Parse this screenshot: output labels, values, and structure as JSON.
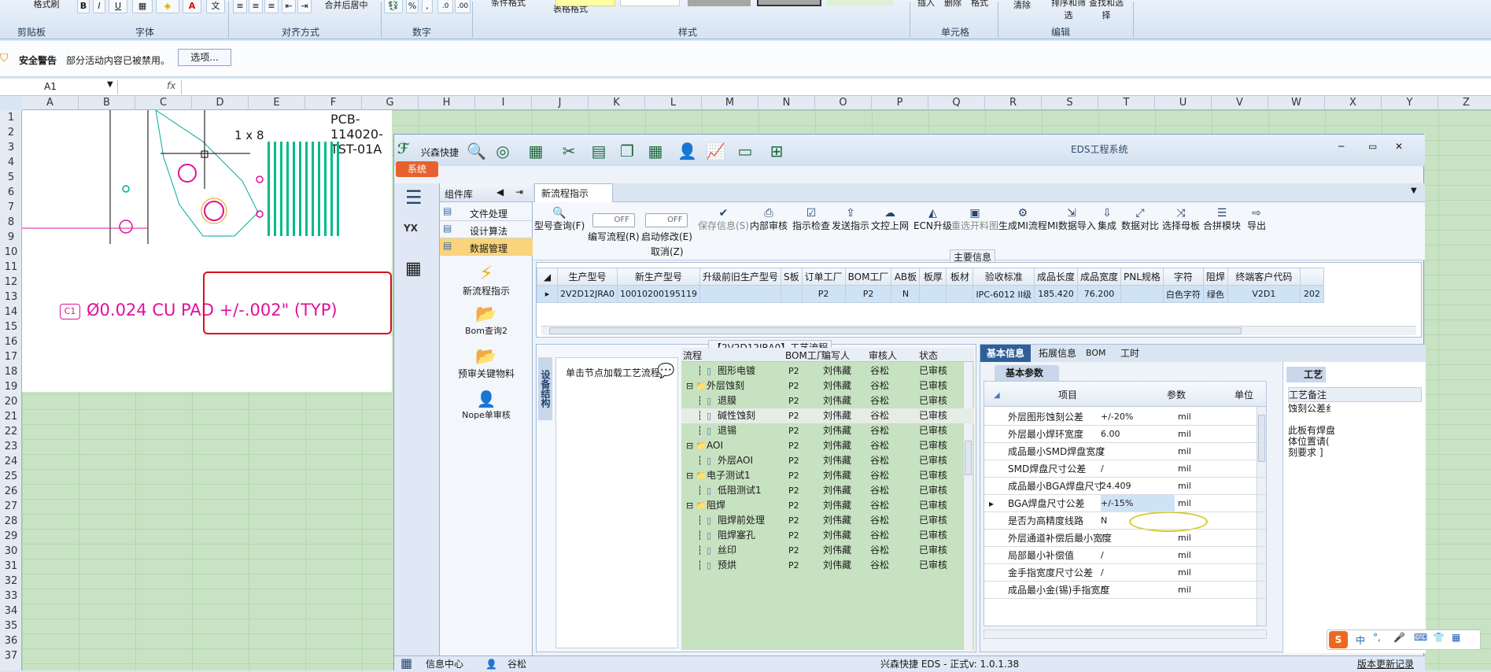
{
  "ribbon": {
    "groups": [
      "剪贴板",
      "字体",
      "对齐方式",
      "数字",
      "样式",
      "单元格",
      "编辑"
    ],
    "format_painter": "格式刷",
    "merge_center": "合并后居中",
    "percent": "%",
    "comma": ",",
    "table_format": "表格格式",
    "conditional": "条件格式",
    "clear": "清除",
    "sort_filter": "排序和筛选",
    "find_select": "查找和选择",
    "insert": "插入",
    "delete": "删除",
    "format": "格式"
  },
  "security_bar": {
    "title": "安全警告",
    "message": "部分活动内容已被禁用。",
    "options_button": "选项..."
  },
  "formula_bar": {
    "name_box": "A1",
    "fx": "fx"
  },
  "columns": [
    "A",
    "B",
    "C",
    "D",
    "E",
    "F",
    "G",
    "H",
    "I",
    "J",
    "K",
    "L",
    "M",
    "N",
    "O",
    "P",
    "Q",
    "R",
    "S",
    "T",
    "U",
    "V",
    "W",
    "X",
    "Y",
    "Z"
  ],
  "rows": [
    "1",
    "2",
    "3",
    "4",
    "5",
    "6",
    "7",
    "8",
    "9",
    "10",
    "11",
    "12",
    "13",
    "14",
    "15",
    "16",
    "17",
    "18",
    "19",
    "20",
    "21",
    "22",
    "23",
    "24",
    "25",
    "26",
    "27",
    "28",
    "29",
    "30",
    "31",
    "32",
    "33",
    "34",
    "35",
    "36",
    "37"
  ],
  "drawing": {
    "title": "PCB-114020-TST-01A",
    "dim_label": "1 x 8",
    "callout_tag": "C1",
    "callout_text": "Ø0.024 CU PAD +/-.002\" (TYP)"
  },
  "eds": {
    "window_title": "EDS工程系统",
    "brand": "兴森快捷",
    "system_tab": "系统",
    "component_header": "组件库",
    "menu": [
      "文件处理",
      "设计算法",
      "数据管理"
    ],
    "components": [
      "新流程指示",
      "Bom查询2",
      "预审关键物料",
      "Nope单审核"
    ],
    "main_tab": "新流程指示",
    "toolbar": [
      {
        "label": "型号查询(F)",
        "icon": "search-icon"
      },
      {
        "label": "编写流程(R)",
        "icon": "toggle-icon"
      },
      {
        "label": "启动修改(E)",
        "icon": "toggle-icon"
      },
      {
        "label": "保存信息(S)",
        "icon": "check-icon"
      },
      {
        "label": "内部审核",
        "icon": "print-icon"
      },
      {
        "label": "指示检查",
        "icon": "checkbox-icon"
      },
      {
        "label": "发送指示",
        "icon": "upload-icon"
      },
      {
        "label": "文控上网",
        "icon": "cloud-icon"
      },
      {
        "label": "ECN升级",
        "icon": "ecn-icon"
      },
      {
        "label": "重选开料图",
        "icon": "image-icon"
      },
      {
        "label": "生成MI流程",
        "icon": "gear-icon"
      },
      {
        "label": "MI数据导入",
        "icon": "import-icon"
      },
      {
        "label": "集成",
        "icon": "download-icon"
      },
      {
        "label": "数据对比",
        "icon": "compare-icon"
      },
      {
        "label": "选择母板",
        "icon": "shuffle-icon"
      },
      {
        "label": "合拼模块",
        "icon": "list-icon"
      },
      {
        "label": "导出",
        "icon": "export-icon"
      }
    ],
    "toggle_off": "OFF",
    "cancel_label": "取消(Z)",
    "main_info_title": "主要信息",
    "main_table": {
      "headers": [
        "生产型号",
        "新生产型号",
        "升级前旧生产型号",
        "S板",
        "订单工厂",
        "BOM工厂",
        "AB板",
        "板厚",
        "板材",
        "验收标准",
        "成品长度",
        "成品宽度",
        "PNL规格",
        "字符",
        "阻焊",
        "终端客户代码",
        ""
      ],
      "row": [
        "2V2D12JRA0",
        "10010200195119",
        "",
        "",
        "P2",
        "P2",
        "N",
        "",
        "",
        "IPC-6012 II级",
        "185.420",
        "76.200",
        "",
        "白色字符",
        "绿色",
        "V2D1",
        "202"
      ]
    },
    "process_title": "【2V2D12JRA0】工艺流程",
    "side_label": "设备结构",
    "click_hint": "单击节点加载工艺流程",
    "tree_headers": [
      "流程",
      "BOM工厂",
      "编写人",
      "审核人",
      "状态"
    ],
    "tree": [
      {
        "name": "图形电镀",
        "level": 2,
        "bom": "P2",
        "writer": "刘伟藏",
        "reviewer": "谷松",
        "status": "已审核"
      },
      {
        "name": "外层蚀刻",
        "level": 1,
        "bom": "P2",
        "writer": "刘伟藏",
        "reviewer": "谷松",
        "status": "已审核"
      },
      {
        "name": "退膜",
        "level": 2,
        "bom": "P2",
        "writer": "刘伟藏",
        "reviewer": "谷松",
        "status": "已审核"
      },
      {
        "name": "碱性蚀刻",
        "level": 2,
        "bom": "P2",
        "writer": "刘伟藏",
        "reviewer": "谷松",
        "status": "已审核"
      },
      {
        "name": "退锡",
        "level": 2,
        "bom": "P2",
        "writer": "刘伟藏",
        "reviewer": "谷松",
        "status": "已审核"
      },
      {
        "name": "AOI",
        "level": 1,
        "bom": "P2",
        "writer": "刘伟藏",
        "reviewer": "谷松",
        "status": "已审核"
      },
      {
        "name": "外层AOI",
        "level": 2,
        "bom": "P2",
        "writer": "刘伟藏",
        "reviewer": "谷松",
        "status": "已审核"
      },
      {
        "name": "电子测试1",
        "level": 1,
        "bom": "P2",
        "writer": "刘伟藏",
        "reviewer": "谷松",
        "status": "已审核"
      },
      {
        "name": "低阻测试1",
        "level": 2,
        "bom": "P2",
        "writer": "刘伟藏",
        "reviewer": "谷松",
        "status": "已审核"
      },
      {
        "name": "阻焊",
        "level": 1,
        "bom": "P2",
        "writer": "刘伟藏",
        "reviewer": "谷松",
        "status": "已审核"
      },
      {
        "name": "阻焊前处理",
        "level": 2,
        "bom": "P2",
        "writer": "刘伟藏",
        "reviewer": "谷松",
        "status": "已审核"
      },
      {
        "name": "阻焊塞孔",
        "level": 2,
        "bom": "P2",
        "writer": "刘伟藏",
        "reviewer": "谷松",
        "status": "已审核"
      },
      {
        "name": "丝印",
        "level": 2,
        "bom": "P2",
        "writer": "刘伟藏",
        "reviewer": "谷松",
        "status": "已审核"
      },
      {
        "name": "预烘",
        "level": 2,
        "bom": "P2",
        "writer": "刘伟藏",
        "reviewer": "谷松",
        "status": "已审核"
      }
    ],
    "right_tabs": [
      "基本信息",
      "拓展信息",
      "BOM",
      "工时"
    ],
    "basic_params_tab": "基本参数",
    "param_headers": [
      "项目",
      "参数",
      "单位"
    ],
    "params": [
      {
        "item": "外层图形蚀刻公差",
        "value": "+/-20%",
        "unit": "mil"
      },
      {
        "item": "外层最小焊环宽度",
        "value": "6.00",
        "unit": "mil"
      },
      {
        "item": "成品最小SMD焊盘宽度",
        "value": "/",
        "unit": "mil"
      },
      {
        "item": "SMD焊盘尺寸公差",
        "value": "/",
        "unit": "mil"
      },
      {
        "item": "成品最小BGA焊盘尺寸",
        "value": "24.409",
        "unit": "mil"
      },
      {
        "item": "BGA焊盘尺寸公差",
        "value": "+/-15%",
        "unit": "mil"
      },
      {
        "item": "是否为高精度线路",
        "value": "N",
        "unit": ""
      },
      {
        "item": "外层通道补偿后最小宽度",
        "value": "/",
        "unit": "mil"
      },
      {
        "item": "局部最小补偿值",
        "value": "/",
        "unit": "mil"
      },
      {
        "item": "金手指宽度尺寸公差",
        "value": "/",
        "unit": "mil"
      },
      {
        "item": "成品最小金(锡)手指宽度",
        "value": "/",
        "unit": "mil"
      }
    ],
    "craft_tab": "工艺",
    "craft_note_title": "工艺备注",
    "craft_note_lines": [
      "蚀刻公差纟",
      "",
      "此板有焊盘",
      "体位置请(",
      "刻要求 ]"
    ],
    "status": {
      "info_center": "信息中心",
      "user": "谷松",
      "version": "兴森快捷 EDS - 正式v: 1.0.1.38",
      "history": "版本更新记录"
    }
  },
  "ime": {
    "lang": "中"
  },
  "colors": {
    "sheet_bg": "#c8e3c3",
    "accent": "#4d78b0",
    "callout": "#e0109a",
    "highlight": "#c7e2c0"
  }
}
